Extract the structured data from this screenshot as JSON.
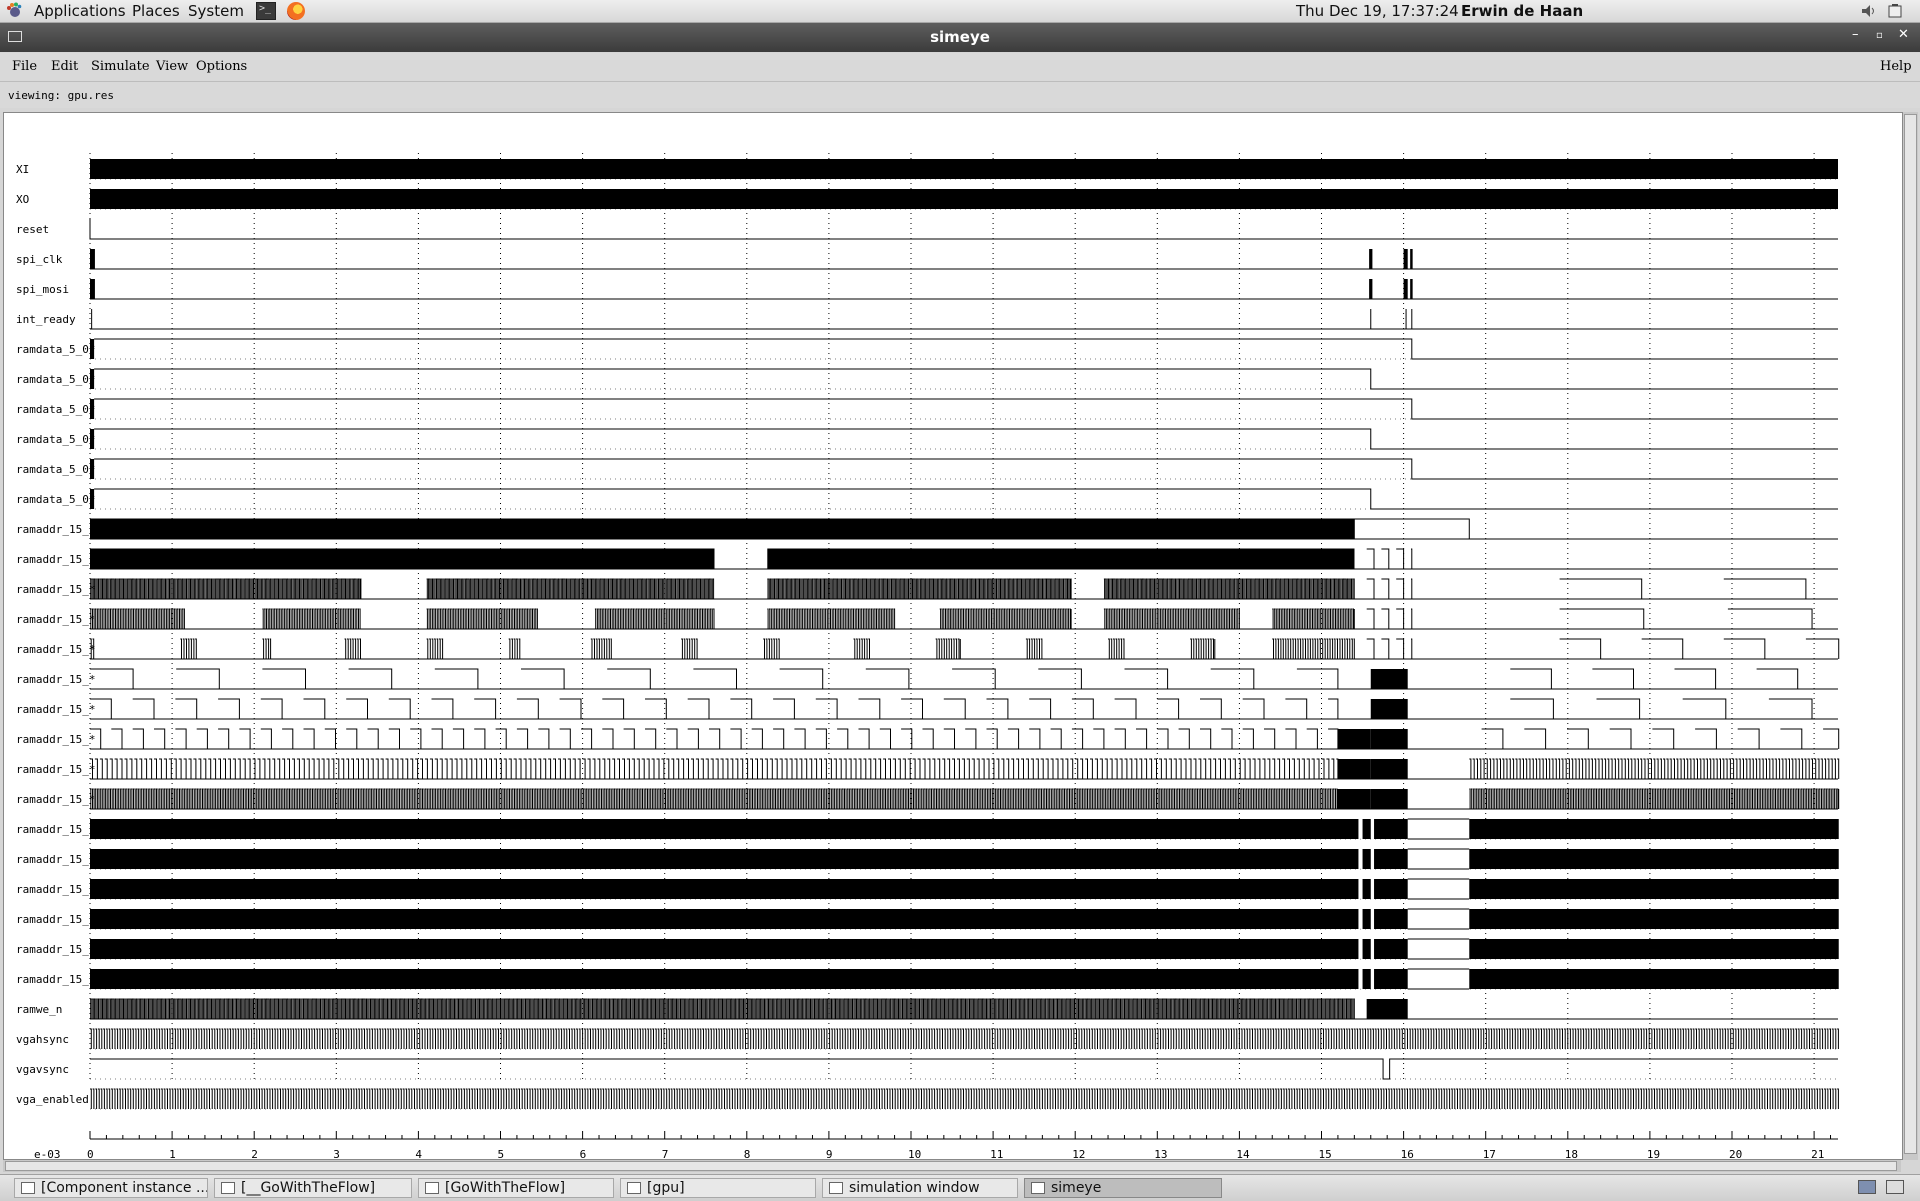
{
  "panel": {
    "applications": "Applications",
    "places": "Places",
    "system": "System",
    "clock": "Thu Dec 19, 17:37:24",
    "user": "Erwin de Haan"
  },
  "window": {
    "title": "simeye"
  },
  "menu": {
    "file": "File",
    "edit": "Edit",
    "simulate": "Simulate",
    "view": "View",
    "options": "Options",
    "help": "Help"
  },
  "status": {
    "viewing": "viewing: gpu.res"
  },
  "axis": {
    "exponent": "e-03",
    "ticks": [
      "0",
      "1",
      "2",
      "3",
      "4",
      "5",
      "6",
      "7",
      "8",
      "9",
      "10",
      "11",
      "12",
      "13",
      "14",
      "15",
      "16",
      "17",
      "18",
      "19",
      "20",
      "21"
    ]
  },
  "signals": [
    {
      "name": "XI",
      "kind": "solid"
    },
    {
      "name": "XO",
      "kind": "solid"
    },
    {
      "name": "reset",
      "kind": "reset"
    },
    {
      "name": "spi_clk",
      "kind": "spi"
    },
    {
      "name": "spi_mosi",
      "kind": "spi"
    },
    {
      "name": "int_ready",
      "kind": "intready"
    },
    {
      "name": "ramdata_5_0*",
      "kind": "step",
      "fall": 16.1
    },
    {
      "name": "ramdata_5_0*",
      "kind": "step",
      "fall": 15.6
    },
    {
      "name": "ramdata_5_0*",
      "kind": "step",
      "fall": 16.1
    },
    {
      "name": "ramdata_5_0*",
      "kind": "step",
      "fall": 15.6
    },
    {
      "name": "ramdata_5_0*",
      "kind": "step",
      "fall": 16.1
    },
    {
      "name": "ramdata_5_0*",
      "kind": "step",
      "fall": 15.6
    },
    {
      "name": "ramaddr_15_*",
      "kind": "addr",
      "level": 0
    },
    {
      "name": "ramaddr_15_*",
      "kind": "addr",
      "level": 1
    },
    {
      "name": "ramaddr_15_*",
      "kind": "addr",
      "level": 2
    },
    {
      "name": "ramaddr_15_*",
      "kind": "addr",
      "level": 3
    },
    {
      "name": "ramaddr_15_*",
      "kind": "addr",
      "level": 4
    },
    {
      "name": "ramaddr_15_*",
      "kind": "addr",
      "level": 5
    },
    {
      "name": "ramaddr_15_*",
      "kind": "addr",
      "level": 6
    },
    {
      "name": "ramaddr_15_*",
      "kind": "addr",
      "level": 7
    },
    {
      "name": "ramaddr_15_*",
      "kind": "addr",
      "level": 8
    },
    {
      "name": "ramaddr_15_*",
      "kind": "addr",
      "level": 9
    },
    {
      "name": "ramaddr_15_*",
      "kind": "addrsolid"
    },
    {
      "name": "ramaddr_15_*",
      "kind": "addrsolid"
    },
    {
      "name": "ramaddr_15_*",
      "kind": "addrsolid"
    },
    {
      "name": "ramaddr_15_*",
      "kind": "addrsolid"
    },
    {
      "name": "ramaddr_15_*",
      "kind": "addrsolid"
    },
    {
      "name": "ramaddr_15_*",
      "kind": "addrsolid"
    },
    {
      "name": "ramwe_n",
      "kind": "ramwe"
    },
    {
      "name": "vgahsync",
      "kind": "dense"
    },
    {
      "name": "vgavsync",
      "kind": "vsync"
    },
    {
      "name": "vga_enabled",
      "kind": "dense"
    }
  ],
  "taskbar": [
    {
      "label": "[Component instance ...",
      "active": false
    },
    {
      "label": "[__GoWithTheFlow]",
      "active": false
    },
    {
      "label": "[GoWithTheFlow]",
      "active": false
    },
    {
      "label": "[gpu]",
      "active": false
    },
    {
      "label": "simulation window",
      "active": false
    },
    {
      "label": "simeye",
      "active": true
    }
  ],
  "colors": {
    "wave": "#000000",
    "grid": "#000000",
    "titlebar": "#4a4a4a"
  }
}
